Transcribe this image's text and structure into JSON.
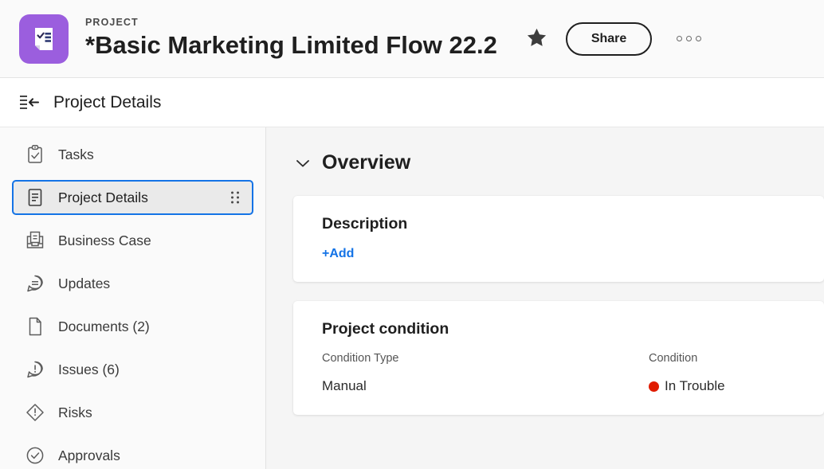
{
  "header": {
    "logo_icon": "project-document-checklist-icon",
    "logo_bg": "#9b5ede",
    "eyebrow": "PROJECT",
    "title": "*Basic Marketing Limited Flow 22.2",
    "favorite_icon": "star-filled-icon",
    "share_label": "Share",
    "more_icon": "more-options-icon"
  },
  "subheader": {
    "collapse_icon": "collapse-panel-left-icon",
    "title": "Project Details"
  },
  "sidebar": {
    "items": [
      {
        "label": "Tasks",
        "icon": "clipboard-check-icon",
        "selected": false
      },
      {
        "label": "Project Details",
        "icon": "document-lines-icon",
        "selected": true
      },
      {
        "label": "Business Case",
        "icon": "business-case-icon",
        "selected": false
      },
      {
        "label": "Updates",
        "icon": "comment-equals-icon",
        "selected": false
      },
      {
        "label": "Documents (2)",
        "icon": "page-icon",
        "selected": false
      },
      {
        "label": "Issues (6)",
        "icon": "comment-alert-icon",
        "selected": false
      },
      {
        "label": "Risks",
        "icon": "diamond-alert-icon",
        "selected": false
      },
      {
        "label": "Approvals",
        "icon": "circle-check-icon",
        "selected": false
      }
    ],
    "drag_handle_icon": "drag-handle-icon"
  },
  "main": {
    "section": {
      "title": "Overview",
      "chevron_icon": "chevron-down-icon",
      "expanded": true
    },
    "description_card": {
      "title": "Description",
      "add_label": "+Add"
    },
    "condition_card": {
      "title": "Project condition",
      "columns": [
        "Condition Type",
        "Condition"
      ],
      "condition_type": "Manual",
      "condition_value": "In Trouble",
      "condition_color": "#e01b00",
      "status_icon": "status-dot-icon"
    }
  },
  "colors": {
    "accent_blue": "#1473e6",
    "brand_purple": "#9b5ede",
    "status_red": "#e01b00",
    "page_bg": "#f5f5f5",
    "card_bg": "#ffffff"
  }
}
